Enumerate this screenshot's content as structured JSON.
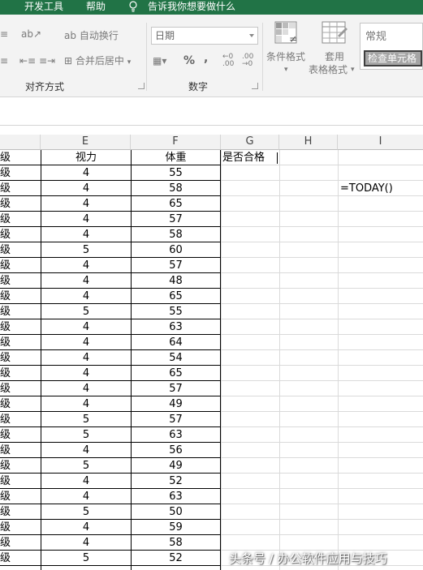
{
  "ribbon_tabs": {
    "developer": "开发工具",
    "help": "帮助",
    "tell_me": "告诉我你想要做什么"
  },
  "alignment": {
    "wrap_text": "自动换行",
    "merge_center": "合并后居中",
    "group_label": "对齐方式"
  },
  "number": {
    "format_value": "日期",
    "percent": "%",
    "comma": ",",
    "group_label": "数字"
  },
  "styles": {
    "conditional_formatting": "条件格式",
    "table_format_1": "套用",
    "table_format_2": "表格格式",
    "style_normal": "常规",
    "style_check_cell": "检查单元格"
  },
  "grid": {
    "columns": [
      "E",
      "F",
      "G",
      "H",
      "I"
    ],
    "left_column_text": "级",
    "headers": {
      "E": "视力",
      "F": "体重",
      "G": "是否合格"
    },
    "formula_cell": "=TODAY()",
    "rows": [
      [
        "4",
        "55"
      ],
      [
        "4",
        "58"
      ],
      [
        "4",
        "65"
      ],
      [
        "4",
        "57"
      ],
      [
        "4",
        "58"
      ],
      [
        "5",
        "60"
      ],
      [
        "4",
        "57"
      ],
      [
        "4",
        "48"
      ],
      [
        "4",
        "65"
      ],
      [
        "5",
        "55"
      ],
      [
        "4",
        "63"
      ],
      [
        "4",
        "64"
      ],
      [
        "4",
        "54"
      ],
      [
        "4",
        "65"
      ],
      [
        "4",
        "57"
      ],
      [
        "4",
        "49"
      ],
      [
        "5",
        "57"
      ],
      [
        "5",
        "63"
      ],
      [
        "4",
        "56"
      ],
      [
        "5",
        "49"
      ],
      [
        "4",
        "52"
      ],
      [
        "4",
        "63"
      ],
      [
        "5",
        "50"
      ],
      [
        "4",
        "59"
      ],
      [
        "4",
        "58"
      ],
      [
        "5",
        "52"
      ]
    ]
  },
  "watermark": "头条号 / 办公软件应用与技巧",
  "colors": {
    "ribbon_green": "#217346",
    "ribbon_bg": "#f3f3f3",
    "gridline": "#dadada",
    "header_bg": "#f2f2f2"
  }
}
